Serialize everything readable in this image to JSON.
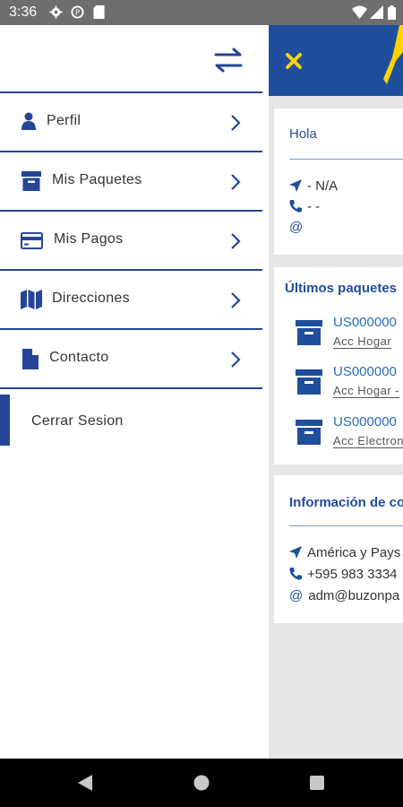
{
  "status_bar": {
    "time": "3:36"
  },
  "drawer": {
    "menu": [
      {
        "label": "Perfil",
        "icon": "user-icon"
      },
      {
        "label": "Mis Paquetes",
        "icon": "archive-box-icon"
      },
      {
        "label": "Mis Pagos",
        "icon": "credit-card-icon"
      },
      {
        "label": "Direcciones",
        "icon": "map-icon"
      },
      {
        "label": "Contacto",
        "icon": "document-icon"
      }
    ],
    "logout_label": "Cerrar Sesion"
  },
  "main": {
    "greeting": "Hola",
    "profile": {
      "address": "- N/A",
      "phone": "- -",
      "email": ""
    },
    "recent_title": "Últimos paquetes",
    "packages": [
      {
        "code": "US000000",
        "desc": "Acc Hogar"
      },
      {
        "code": "US000000",
        "desc": "Acc Hogar -"
      },
      {
        "code": "US000000",
        "desc": "Acc Electron"
      }
    ],
    "info_title": "Información de co",
    "contact": {
      "address": "América y Pays",
      "phone": "+595 983 3334",
      "email": "adm@buzonpa"
    }
  },
  "colors": {
    "primary": "#1f4e9c",
    "accent": "#ffd200",
    "status_bar": "#6e6e6e"
  }
}
